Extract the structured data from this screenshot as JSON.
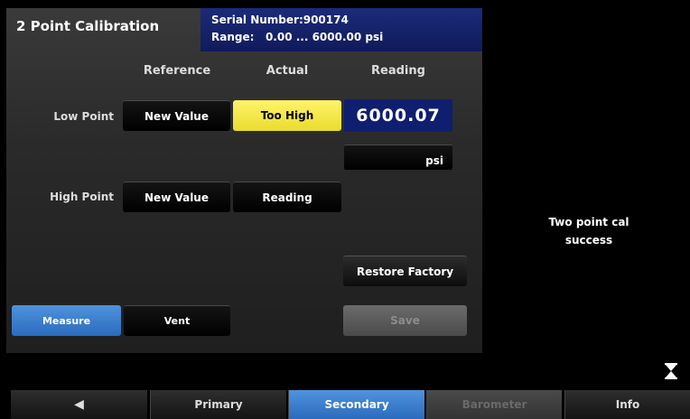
{
  "screen": {
    "title": "2 Point Calibration",
    "serial_line": "Serial Number:900174",
    "range_line": "Range:   0.00 ... 6000.00 psi"
  },
  "columns": {
    "reference": "Reference",
    "actual": "Actual",
    "reading": "Reading"
  },
  "low_point": {
    "label": "Low Point",
    "reference_btn": "New Value",
    "actual_btn": "Too High",
    "reading_value": "6000.07",
    "unit": "psi"
  },
  "high_point": {
    "label": "High Point",
    "reference_btn": "New Value",
    "actual_btn": "Reading"
  },
  "actions": {
    "restore": "Restore Factory",
    "save": "Save",
    "measure": "Measure",
    "vent": "Vent"
  },
  "status": {
    "line1": "Two point cal",
    "line2": "success"
  },
  "nav": {
    "back": "◀",
    "primary": "Primary",
    "secondary": "Secondary",
    "barometer": "Barometer",
    "info": "Info"
  },
  "colors": {
    "accent_blue": "#3a7fd0",
    "warning_yellow": "#f5ea4a",
    "reading_navy": "#0f1e6e"
  }
}
